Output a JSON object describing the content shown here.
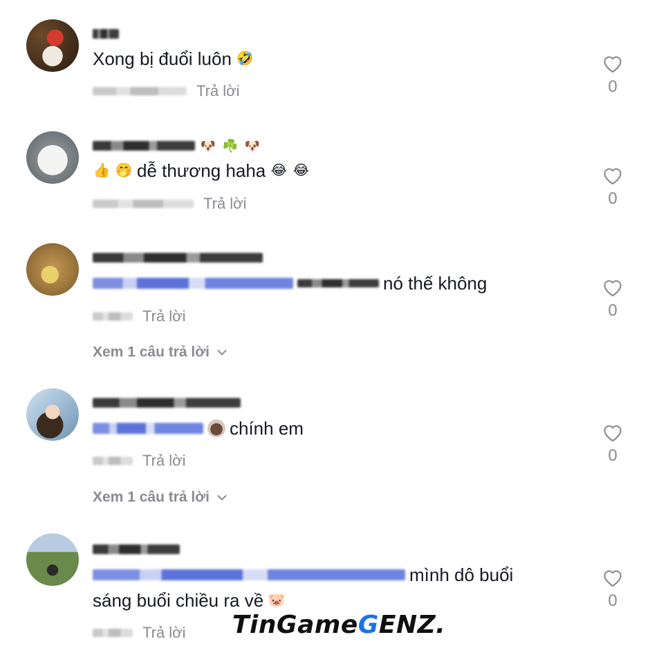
{
  "comments": [
    {
      "text": "Xong bị đuổi luôn",
      "emojis": [
        "🤣"
      ],
      "reply_label": "Trả lời",
      "like_count": "0"
    },
    {
      "text": "dễ thương haha",
      "emojis_before": [
        "👍",
        "🤭"
      ],
      "emojis_after": [
        "😂",
        "😂"
      ],
      "username_emojis": [
        "🐶",
        "☘️",
        "🐶"
      ],
      "reply_label": "Trả lời",
      "like_count": "0"
    },
    {
      "text": "nó thế không",
      "reply_label": "Trả lời",
      "like_count": "0",
      "view_replies": "Xem 1 câu trả lời"
    },
    {
      "text": "chính em",
      "emojis": [
        "🟤"
      ],
      "reply_label": "Trả lời",
      "like_count": "0",
      "view_replies": "Xem 1 câu trả lời"
    },
    {
      "text": "mình dô buổi",
      "text_line2": "sáng buổi chiều ra về",
      "emojis": [
        "🐷"
      ],
      "reply_label": "Trả lời",
      "like_count": "0"
    }
  ],
  "watermark": {
    "part1": "TinGame",
    "part2": "G",
    "part3": "ENZ."
  },
  "icons": {
    "like": "heart-outline-icon",
    "expand": "chevron-down-icon"
  }
}
